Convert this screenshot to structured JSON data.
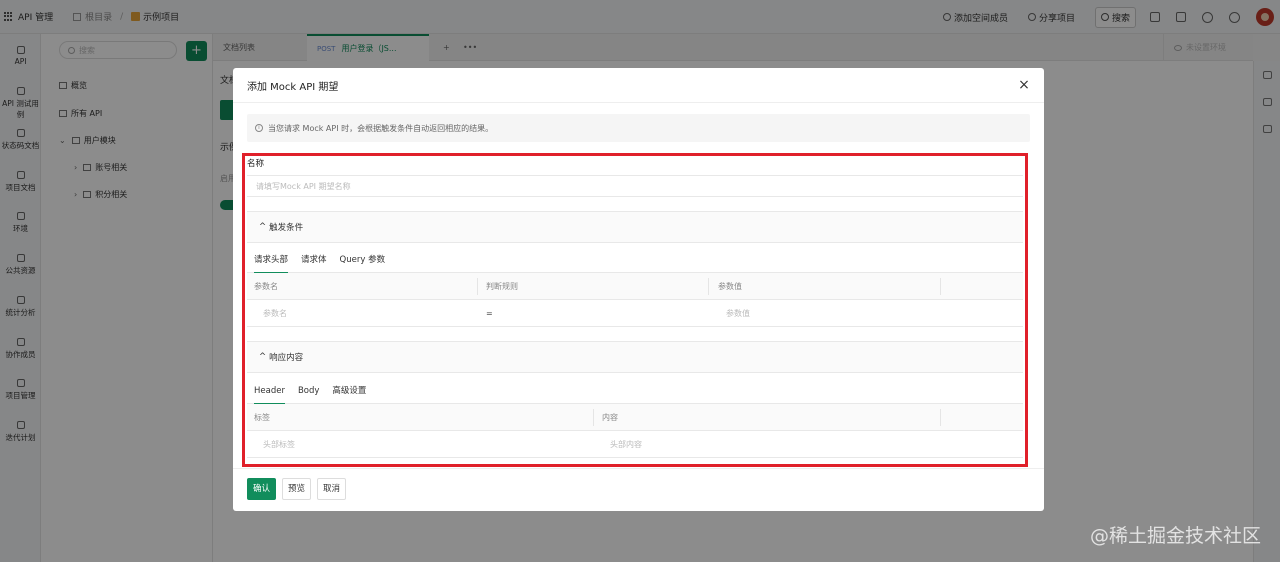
{
  "topbar": {
    "app_title": "API 管理",
    "breadcrumb_root": "根目录",
    "breadcrumb_sep": "/",
    "breadcrumb_project": "示例项目",
    "add_member": "添加空间成员",
    "share_project": "分享项目",
    "search": "搜索"
  },
  "rail": {
    "items": [
      "API",
      "API 测试用例",
      "状态码文档",
      "项目文档",
      "环境",
      "公共资源",
      "统计分析",
      "协作成员",
      "项目管理",
      "迭代计划"
    ]
  },
  "tree": {
    "search_placeholder": "搜索",
    "add_label": "+",
    "overview": "概览",
    "all_api": "所有 API",
    "user_module": "用户模块",
    "account": "账号相关",
    "points": "积分相关"
  },
  "tabs": {
    "doc_list": "文档列表",
    "method": "POST",
    "active_tab": "用户登录（JS...",
    "add": "+",
    "more": "•••",
    "env": "未设置环境"
  },
  "background": {
    "doc_label": "文档",
    "example_label": "示例",
    "enable_label": "启用"
  },
  "modal": {
    "title": "添加 Mock API 期望",
    "close": "×",
    "notice": "当您请求 Mock API 时，会根据触发条件自动返回相应的结果。",
    "name_label": "名称",
    "name_placeholder": "请填写Mock API 期望名称",
    "trigger_section": "触发条件",
    "trigger_tabs": [
      "请求头部",
      "请求体",
      "Query 参数"
    ],
    "trigger_headers": [
      "参数名",
      "判断规则",
      "参数值"
    ],
    "trigger_row": [
      "参数名",
      "=",
      "参数值"
    ],
    "response_section": "响应内容",
    "response_tabs": [
      "Header",
      "Body",
      "高级设置"
    ],
    "response_headers": [
      "标签",
      "内容"
    ],
    "response_row": [
      "头部标签",
      "头部内容"
    ],
    "confirm": "确认",
    "preview": "预览",
    "cancel": "取消"
  },
  "watermark": "@稀土掘金技术社区",
  "colors": {
    "primary": "#118d5c",
    "highlight_border": "#e0202a"
  }
}
